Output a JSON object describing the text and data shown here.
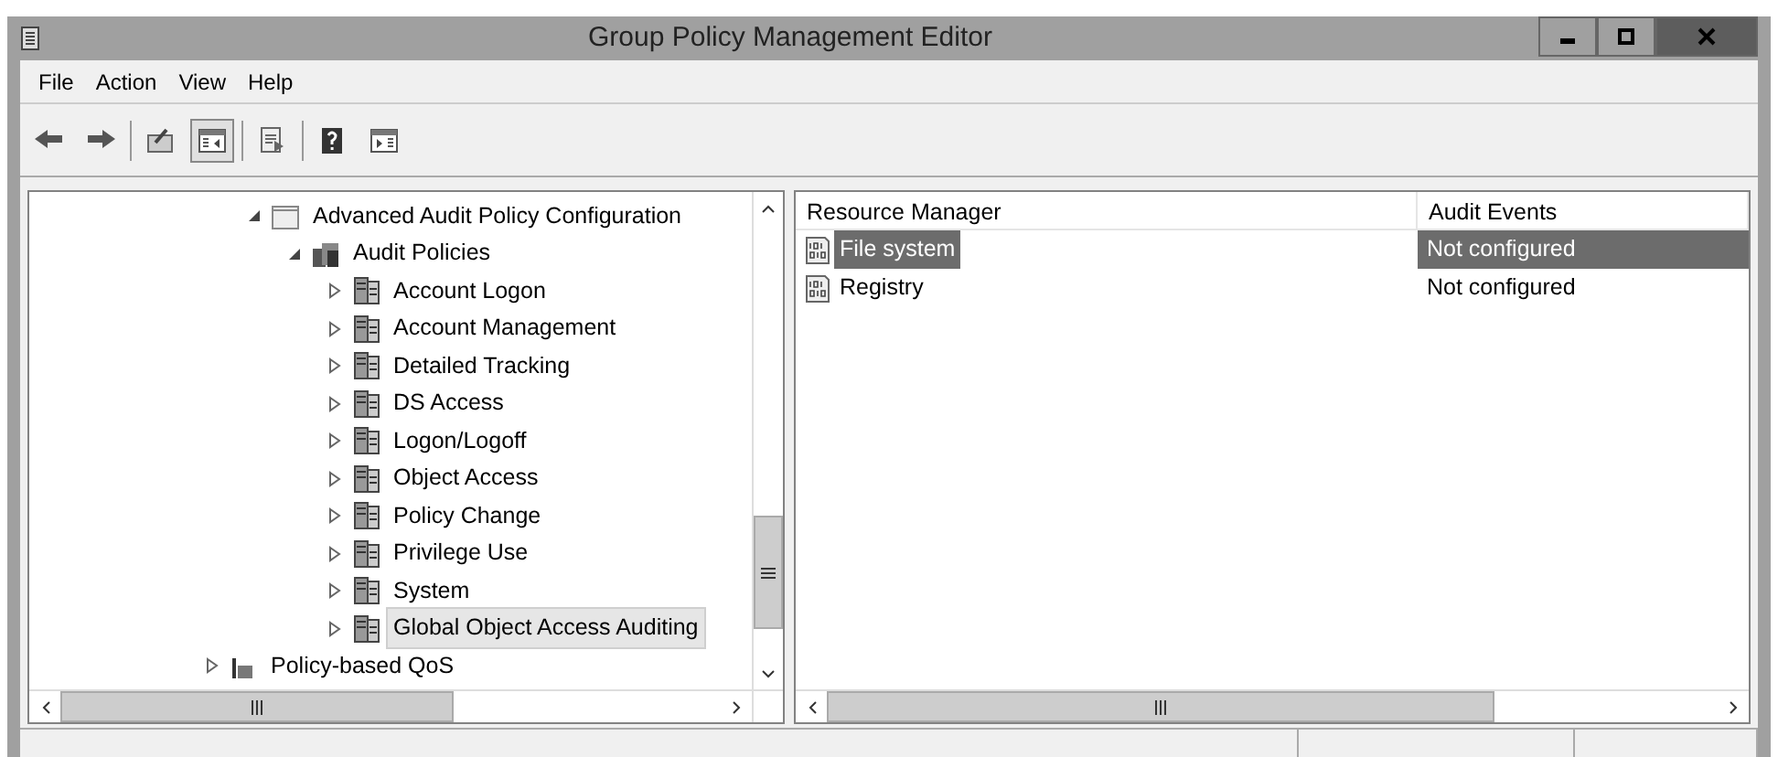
{
  "window": {
    "title": "Group Policy Management Editor"
  },
  "menu": [
    "File",
    "Action",
    "View",
    "Help"
  ],
  "toolbar": [
    {
      "kind": "back",
      "pressed": false
    },
    {
      "kind": "forward",
      "pressed": false
    },
    {
      "kind": "sep"
    },
    {
      "kind": "up",
      "pressed": false
    },
    {
      "kind": "tree",
      "pressed": true
    },
    {
      "kind": "sep"
    },
    {
      "kind": "export",
      "pressed": false
    },
    {
      "kind": "sep"
    },
    {
      "kind": "help",
      "pressed": false
    },
    {
      "kind": "pane",
      "pressed": false
    }
  ],
  "tree": [
    {
      "label": "Advanced Audit Policy Configuration",
      "kind": "folder",
      "expanded": true,
      "selected": false,
      "children": [
        {
          "label": "Audit Policies",
          "kind": "policies",
          "expanded": true,
          "selected": false,
          "children": [
            {
              "label": "Account Logon",
              "kind": "category",
              "expanded": false,
              "selected": false
            },
            {
              "label": "Account Management",
              "kind": "category",
              "expanded": false,
              "selected": false
            },
            {
              "label": "Detailed Tracking",
              "kind": "category",
              "expanded": false,
              "selected": false
            },
            {
              "label": "DS Access",
              "kind": "category",
              "expanded": false,
              "selected": false
            },
            {
              "label": "Logon/Logoff",
              "kind": "category",
              "expanded": false,
              "selected": false
            },
            {
              "label": "Object Access",
              "kind": "category",
              "expanded": false,
              "selected": false
            },
            {
              "label": "Policy Change",
              "kind": "category",
              "expanded": false,
              "selected": false
            },
            {
              "label": "Privilege Use",
              "kind": "category",
              "expanded": false,
              "selected": false
            },
            {
              "label": "System",
              "kind": "category",
              "expanded": false,
              "selected": false
            },
            {
              "label": "Global Object Access Auditing",
              "kind": "category",
              "expanded": false,
              "selected": true
            }
          ]
        }
      ]
    },
    {
      "label": "Policy-based QoS",
      "kind": "chart",
      "expanded": false,
      "selected": false
    }
  ],
  "table": {
    "columns": [
      "Resource Manager",
      "Audit Events"
    ],
    "rows": [
      {
        "cells": [
          "File system",
          "Not configured"
        ],
        "selected": true
      },
      {
        "cells": [
          "Registry",
          "Not configured"
        ],
        "selected": false
      }
    ]
  }
}
